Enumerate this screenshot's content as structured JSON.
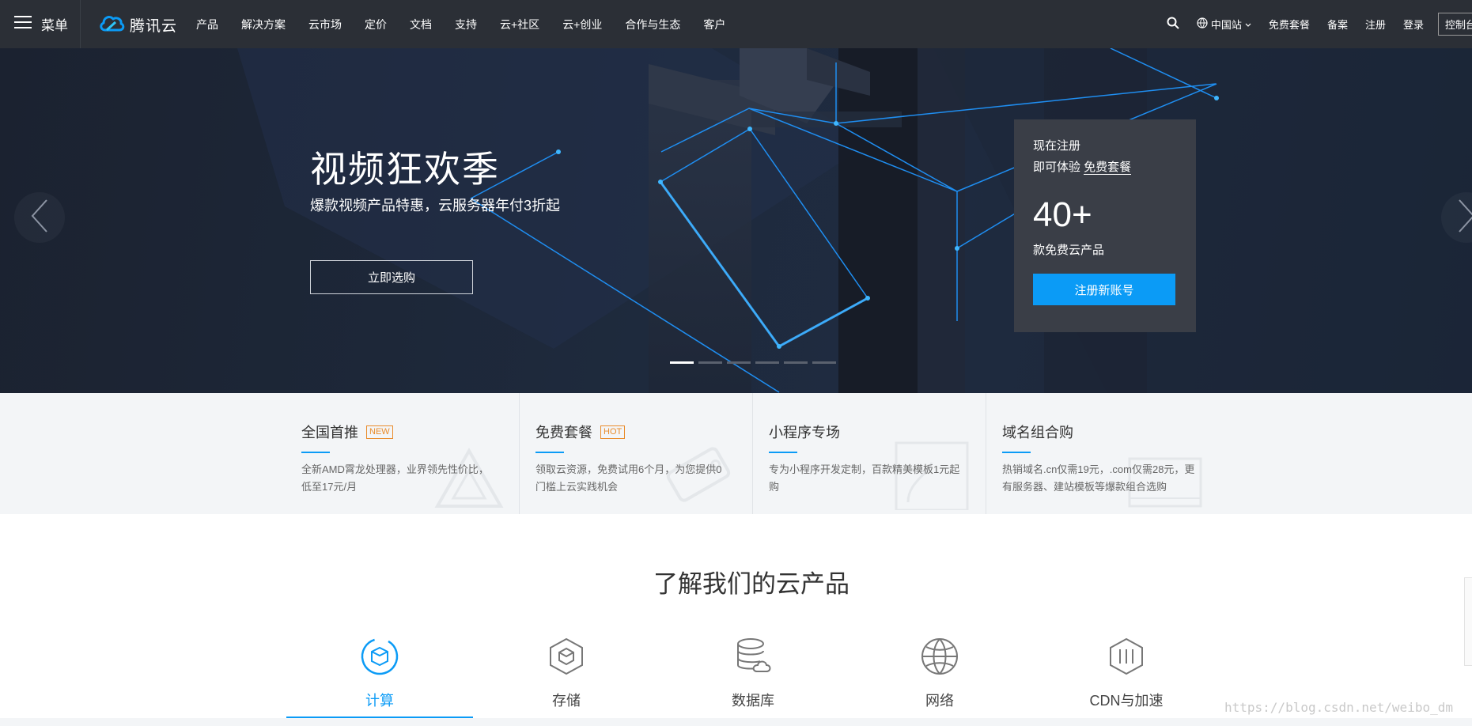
{
  "topbar": {
    "menu_label": "菜单",
    "logo_text": "腾讯云",
    "nav": [
      "产品",
      "解决方案",
      "云市场",
      "定价",
      "文档",
      "支持",
      "云+社区",
      "云+创业",
      "合作与生态",
      "客户"
    ],
    "region": "中国站",
    "free": "免费套餐",
    "filing": "备案",
    "register": "注册",
    "login": "登录",
    "console": "控制台"
  },
  "hero": {
    "title": "视频狂欢季",
    "subtitle": "爆款视频产品特惠，云服务器年付3折起",
    "cta": "立即选购",
    "slides": 6,
    "active_slide": 0
  },
  "register_card": {
    "line1": "现在注册",
    "line2_prefix": "即可体验 ",
    "line2_link": "免费套餐",
    "count": "40+",
    "desc": "款免费云产品",
    "button": "注册新账号"
  },
  "promos": [
    {
      "title": "全国首推",
      "badge": "NEW",
      "desc": "全新AMD霄龙处理器，业界领先性价比，低至17元/月"
    },
    {
      "title": "免费套餐",
      "badge": "HOT",
      "desc": "领取云资源，免费试用6个月，为您提供0门槛上云实践机会"
    },
    {
      "title": "小程序专场",
      "badge": "",
      "desc": "专为小程序开发定制，百款精美模板1元起购"
    },
    {
      "title": "域名组合购",
      "badge": "",
      "desc": "热销域名.cn仅需19元，.com仅需28元，更有服务器、建站模板等爆款组合选购"
    }
  ],
  "products": {
    "title": "了解我们的云产品",
    "tabs": [
      "计算",
      "存储",
      "数据库",
      "网络",
      "CDN与加速"
    ],
    "active_tab": 0
  },
  "watermark": "https://blog.csdn.net/weibo_dm",
  "colors": {
    "accent": "#0b9bf6",
    "topbar": "#2b2f36",
    "hero": "#1e2a3d",
    "card": "#3a3e47",
    "badge": "#e98b2a"
  }
}
